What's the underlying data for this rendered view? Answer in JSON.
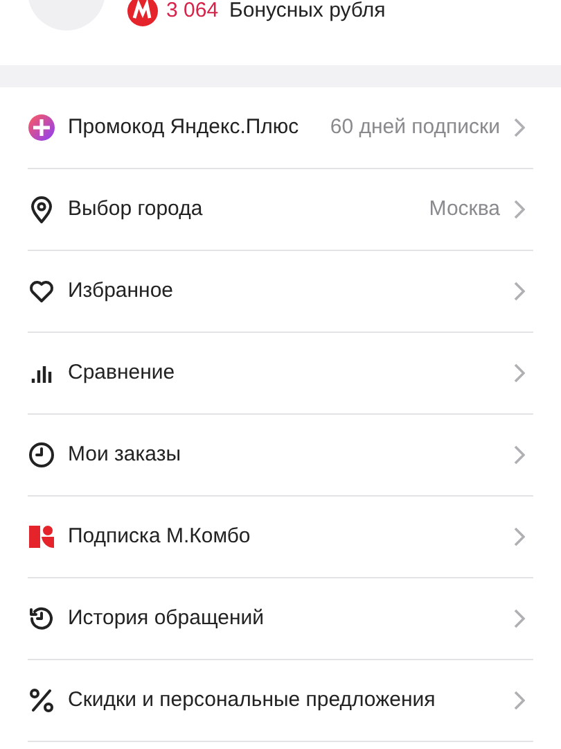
{
  "bonus": {
    "amount": "3 064",
    "label": "Бонусных рубля"
  },
  "menu": [
    {
      "label": "Промокод Яндекс.Плюс",
      "value": "60 дней подписки"
    },
    {
      "label": "Выбор города",
      "value": "Москва"
    },
    {
      "label": "Избранное"
    },
    {
      "label": "Сравнение"
    },
    {
      "label": "Мои заказы"
    },
    {
      "label": "Подписка М.Комбо"
    },
    {
      "label": "История обращений"
    },
    {
      "label": "Скидки и персональные предложения"
    }
  ]
}
